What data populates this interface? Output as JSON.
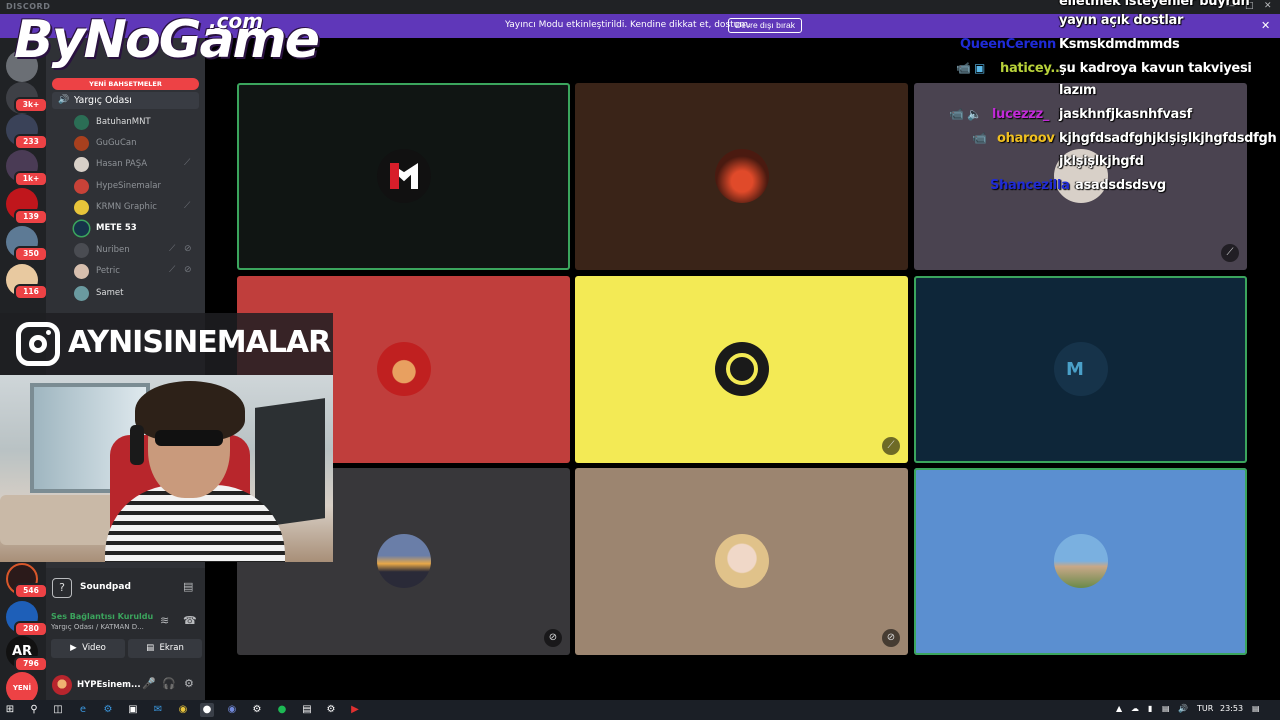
{
  "window": {
    "brand": "DISCORD"
  },
  "banner": {
    "message": "Yayıncı Modu etkinleştirildi. Kendine dikkat et, dostum.",
    "disable_label": "Devre dışı bırak"
  },
  "overlay": {
    "logo_main": "ByNoGame",
    "logo_com": ".com",
    "instagram_handle": "AYNISINEMALAR"
  },
  "rail": {
    "badges": [
      "3k+",
      "233",
      "1k+",
      "139",
      "350",
      "116",
      "546",
      "280",
      "796"
    ],
    "new_label": "YENİ"
  },
  "sidebar": {
    "new_mentions": "YENİ BAHSETMELER",
    "voice_channel": "Yargıç Odası",
    "members": [
      {
        "name": "BatuhanMNT"
      },
      {
        "name": "GuGuCan"
      },
      {
        "name": "Hasan PAŞA"
      },
      {
        "name": "HypeSinemalar"
      },
      {
        "name": "KRMN Graphic"
      },
      {
        "name": "METE 53"
      },
      {
        "name": "Nuriben"
      },
      {
        "name": "Petric"
      },
      {
        "name": "Samet"
      }
    ]
  },
  "lowpanel": {
    "soundpad": "Soundpad",
    "voice_status": "Ses Bağlantısı Kuruldu",
    "voice_sub": "Yargıç Odası / KATMAN D...",
    "video_label": "Video",
    "screen_label": "Ekran",
    "username": "HYPEsinem..."
  },
  "chat": {
    "messages": [
      {
        "nick": "",
        "text": "elletmek isteyenler buyrun"
      },
      {
        "nick": "",
        "text": "yayın açık dostlar"
      },
      {
        "nick": "QueenCerenn",
        "text": "Ksmskdmdmmds",
        "color": "#1f2bd6"
      },
      {
        "nick": "haticey...",
        "text": "şu kadroya kavun takviyesi",
        "color": "#b8d23a"
      },
      {
        "nick": "",
        "text": "lazım"
      },
      {
        "nick": "lucezzz_",
        "text": "jaskhnfjkasnhfvasf",
        "color": "#c22ad8"
      },
      {
        "nick": "oharoov",
        "text": "kjhgfdsadfghjklşişlkjhgfdsdfgh",
        "color": "#f0c020"
      },
      {
        "nick": "",
        "text": "jklşişlkjhgfd"
      },
      {
        "nick": "Shancezilla",
        "text": "asadsdsdsvg",
        "color": "#1f2bd6"
      }
    ]
  },
  "taskbar": {
    "lang": "TUR",
    "time": "23:53"
  },
  "colors": {
    "banner": "#5f37b9",
    "speaking": "#3ba55d",
    "badge": "#ed4245"
  }
}
